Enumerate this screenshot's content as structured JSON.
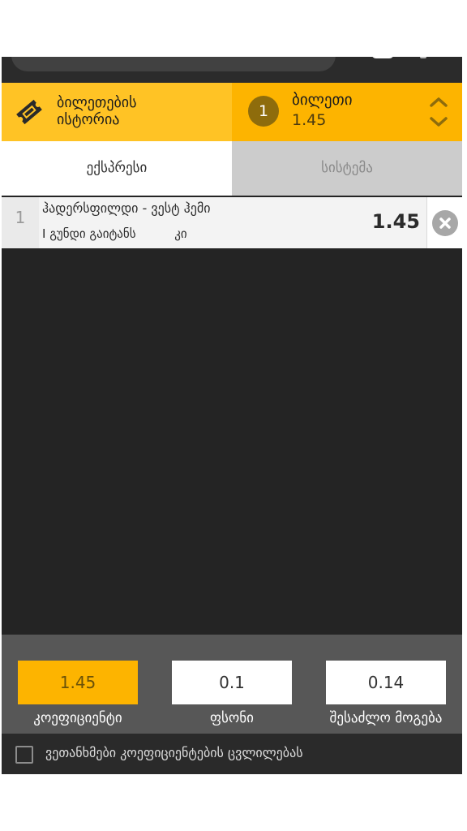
{
  "header": {
    "history_label_line1": "ბილეთების",
    "history_label_line2": "ისტორია",
    "bet_count": "1",
    "bet_title": "ბილეთი",
    "bet_odds": "1.45"
  },
  "tabs": [
    {
      "label": "ექსპრესი",
      "active": true
    },
    {
      "label": "სისტემა",
      "active": false
    }
  ],
  "selection": {
    "index": "1",
    "match": "ჰადერსფილდი - ვესტ ჰემი",
    "market": "I გუნდი გაიტანს          კი",
    "odds": "1.45"
  },
  "summary": {
    "odds_value": "1.45",
    "odds_label": "კოეფიციენტი",
    "stake_value": "0.1",
    "stake_label": "ფსონი",
    "win_value": "0.14",
    "win_label": "შესაძლო მოგება"
  },
  "agree": {
    "text": "ვეთანხმები კოეფიციენტების ცვლილებას",
    "checked": false
  },
  "colors": {
    "accent": "#fdb400",
    "accent_light": "#ffc325",
    "background": "#242424"
  }
}
